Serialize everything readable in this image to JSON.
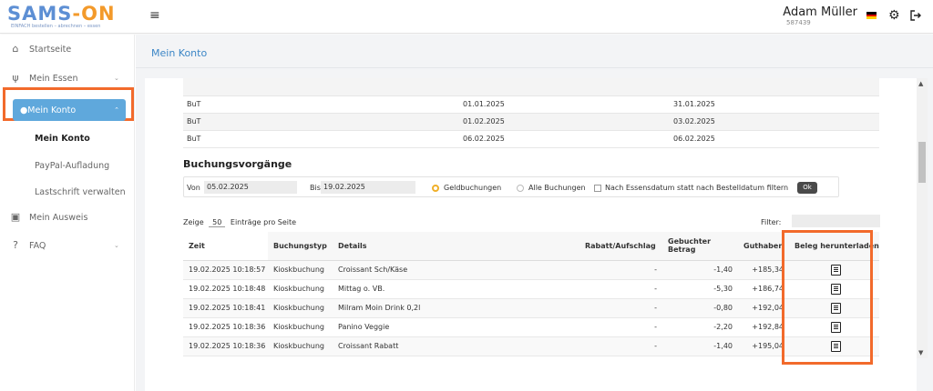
{
  "header": {
    "logo_text_1": "SAMS",
    "logo_text_2": "-",
    "logo_text_3": "ON",
    "logo_tagline": "EINFACH bestellen – abrechnen – essen",
    "user_name": "Adam Müller",
    "user_id": "587439"
  },
  "sidebar": {
    "items": [
      {
        "label": "Startseite",
        "icon": "home-icon"
      },
      {
        "label": "Mein Essen",
        "icon": "cutlery-icon"
      },
      {
        "label": "Mein Konto",
        "icon": "piggy-bank-icon"
      },
      {
        "label": "Mein Ausweis",
        "icon": "id-card-icon"
      },
      {
        "label": "FAQ",
        "icon": "help-icon"
      }
    ],
    "subitems": [
      {
        "label": "Mein Konto"
      },
      {
        "label": "PayPal-Aufladung"
      },
      {
        "label": "Lastschrift verwalten"
      }
    ],
    "active_color": "#5fa8dc",
    "highlight_color": "#f26a2b"
  },
  "main": {
    "page_title": "Mein Konto",
    "top_rows": [
      [
        "BuT",
        "01.01.2025",
        "31.01.2025"
      ],
      [
        "BuT",
        "01.02.2025",
        "03.02.2025"
      ],
      [
        "BuT",
        "06.02.2025",
        "06.02.2025"
      ]
    ],
    "section_title": "Buchungsvorgänge",
    "filter": {
      "von_label": "Von",
      "von_value": "05.02.2025",
      "bis_label": "Bis",
      "bis_value": "19.02.2025",
      "radio_geld": "Geldbuchungen",
      "radio_alle": "Alle Buchungen",
      "checkbox_label": "Nach Essensdatum statt nach Bestelldatum filtern",
      "ok_label": "Ok"
    },
    "show_prefix": "Zeige",
    "show_value": "50",
    "show_suffix": "Einträge pro Seite",
    "filter_label": "Filter:",
    "columns": [
      "Zeit",
      "Buchungstyp",
      "Details",
      "Rabatt/Aufschlag",
      "Gebuchter Betrag",
      "Guthaben",
      "Beleg herunterladen"
    ],
    "rows": [
      {
        "zeit": "19.02.2025 10:18:57",
        "typ": "Kioskbuchung",
        "details": "Croissant Sch/Käse",
        "rabatt": "-",
        "betrag": "-1,40",
        "guthaben": "+185,34"
      },
      {
        "zeit": "19.02.2025 10:18:48",
        "typ": "Kioskbuchung",
        "details": "Mittag o. VB.",
        "rabatt": "-",
        "betrag": "-5,30",
        "guthaben": "+186,74"
      },
      {
        "zeit": "19.02.2025 10:18:41",
        "typ": "Kioskbuchung",
        "details": "Milram Moin Drink 0,2l",
        "rabatt": "-",
        "betrag": "-0,80",
        "guthaben": "+192,04"
      },
      {
        "zeit": "19.02.2025 10:18:36",
        "typ": "Kioskbuchung",
        "details": "Panino Veggie",
        "rabatt": "-",
        "betrag": "-2,20",
        "guthaben": "+192,84"
      },
      {
        "zeit": "19.02.2025 10:18:36",
        "typ": "Kioskbuchung",
        "details": "Croissant Rabatt",
        "rabatt": "-",
        "betrag": "-1,40",
        "guthaben": "+195,04"
      }
    ]
  }
}
